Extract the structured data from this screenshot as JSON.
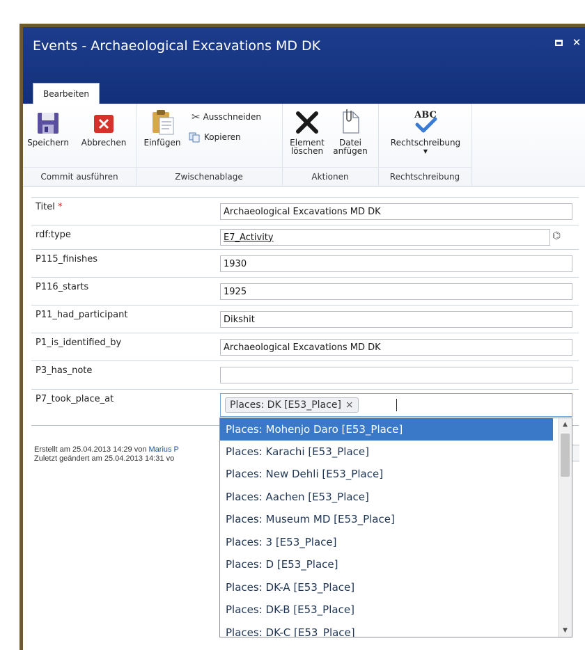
{
  "window": {
    "title": "Events - Archaeological Excavations MD DK",
    "tab_label": "Bearbeiten"
  },
  "ribbon": {
    "commit": {
      "group_label": "Commit ausführen",
      "save_label": "Speichern",
      "cancel_label": "Abbrechen"
    },
    "clipboard": {
      "group_label": "Zwischenablage",
      "paste_label": "Einfügen",
      "cut_label": "Ausschneiden",
      "copy_label": "Kopieren"
    },
    "actions": {
      "group_label": "Aktionen",
      "delete_label_1": "Element",
      "delete_label_2": "löschen",
      "attach_label_1": "Datei",
      "attach_label_2": "anfügen"
    },
    "spelling": {
      "group_label": "Rechtschreibung",
      "spell_label": "Rechtschreibung",
      "spell_icon_text": "ABC"
    }
  },
  "form": {
    "fields": [
      {
        "label": "Titel",
        "required_mark": "*",
        "value": "Archaeological Excavations MD  DK"
      },
      {
        "label": "rdf:type",
        "value": "E7_Activity"
      },
      {
        "label": "P115_finishes",
        "value": "1930"
      },
      {
        "label": "P116_starts",
        "value": "1925"
      },
      {
        "label": "P11_had_participant",
        "value": "Dikshit"
      },
      {
        "label": "P1_is_identified_by",
        "value": "Archaeological Excavations MD  DK"
      },
      {
        "label": "P3_has_note",
        "value": ""
      },
      {
        "label": "P7_took_place_at",
        "token": "Places: DK [E53_Place]",
        "token_remove": "×"
      }
    ]
  },
  "meta": {
    "created_prefix": "Erstellt am 25.04.2013 14:29 von ",
    "created_author": "Marius P",
    "modified_prefix": "Zuletzt geändert am 25.04.2013 14:31 vo"
  },
  "dropdown": {
    "options": [
      "Places: Mohenjo Daro [E53_Place]",
      "Places: Karachi [E53_Place]",
      "Places: New Dehli [E53_Place]",
      "Places: Aachen [E53_Place]",
      "Places: Museum MD [E53_Place]",
      "Places: 3 [E53_Place]",
      "Places: D [E53_Place]",
      "Places: DK-A [E53_Place]",
      "Places: DK-B [E53_Place]",
      "Places: DK-C [E53_Place]"
    ],
    "selected_index": 0
  },
  "colors": {
    "titlebar": "#1d3c8c",
    "selection": "#3a78c8",
    "required": "#e0241b"
  }
}
